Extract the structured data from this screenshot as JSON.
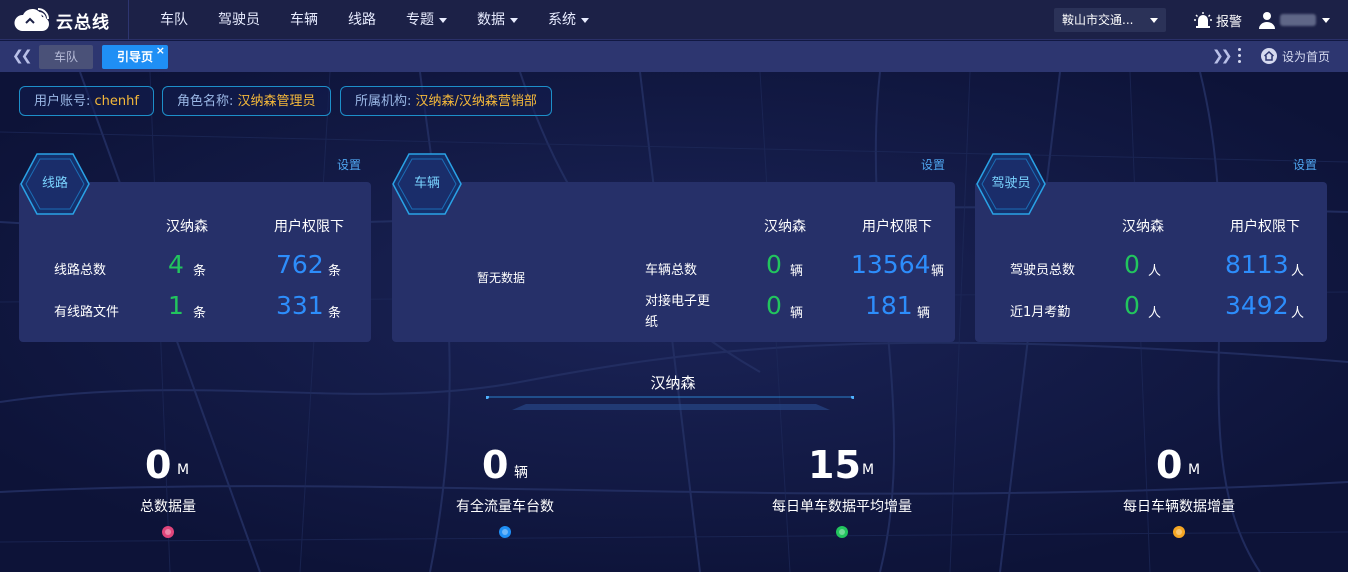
{
  "app": {
    "logo_text": "云总线"
  },
  "nav": [
    {
      "label": "车队",
      "has_caret": false
    },
    {
      "label": "驾驶员",
      "has_caret": false
    },
    {
      "label": "车辆",
      "has_caret": false
    },
    {
      "label": "线路",
      "has_caret": false
    },
    {
      "label": "专题",
      "has_caret": true
    },
    {
      "label": "数据",
      "has_caret": true
    },
    {
      "label": "系统",
      "has_caret": true
    }
  ],
  "region_select": {
    "value": "鞍山市交通..."
  },
  "alarm": {
    "label": "报警"
  },
  "tabs": [
    {
      "label": "车队",
      "active": false
    },
    {
      "label": "引导页",
      "active": true,
      "close": "×"
    }
  ],
  "set_home": {
    "label": "设为首页"
  },
  "info": {
    "account_label": "用户账号:",
    "account_value": "chenhf",
    "role_label": "角色名称:",
    "role_value": "汉纳森管理员",
    "org_label": "所属机构:",
    "org_value": "汉纳森/汉纳森营销部"
  },
  "cards": {
    "setting_label": "设置",
    "route": {
      "title": "线路",
      "col1": "汉纳森",
      "col2": "用户权限下",
      "rows": [
        {
          "label": "线路总数",
          "v1": "4",
          "u1": "条",
          "v2": "762",
          "u2": "条"
        },
        {
          "label": "有线路文件",
          "v1": "1",
          "u1": "条",
          "v2": "331",
          "u2": "条"
        }
      ]
    },
    "vehicle": {
      "title": "车辆",
      "no_data": "暂无数据",
      "col1": "汉纳森",
      "col2": "用户权限下",
      "rows": [
        {
          "label": "车辆总数",
          "v1": "0",
          "u1": "辆",
          "v2": "13564",
          "u2": "辆"
        },
        {
          "label_line1": "对接电子更",
          "label_line2": "纸",
          "v1": "0",
          "u1": "辆",
          "v2": "181",
          "u2": "辆"
        }
      ]
    },
    "driver": {
      "title": "驾驶员",
      "col1": "汉纳森",
      "col2": "用户权限下",
      "rows": [
        {
          "label": "驾驶员总数",
          "v1": "0",
          "u1": "人",
          "v2": "8113",
          "u2": "人"
        },
        {
          "label": "近1月考勤",
          "v1": "0",
          "u1": "人",
          "v2": "3492",
          "u2": "人"
        }
      ]
    }
  },
  "center_title": "汉纳森",
  "stats": [
    {
      "value": "0",
      "unit": "M",
      "label": "总数据量",
      "color": "#e0457b"
    },
    {
      "value": "0",
      "unit": "辆",
      "label": "有全流量车台数",
      "color": "#1f8ff5"
    },
    {
      "value": "15",
      "unit": "M",
      "label": "每日单车数据平均增量",
      "color": "#22c55e"
    },
    {
      "value": "0",
      "unit": "M",
      "label": "每日车辆数据增量",
      "color": "#f5a623"
    }
  ]
}
